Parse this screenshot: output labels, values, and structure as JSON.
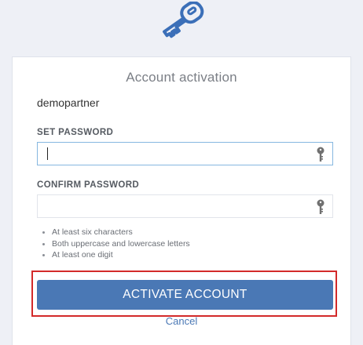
{
  "logo": {
    "icon": "key-icon",
    "color": "#3b6fb8"
  },
  "card": {
    "title": "Account activation",
    "username": "demopartner"
  },
  "form": {
    "set_password": {
      "label": "SET PASSWORD",
      "value": "",
      "icon": "key-icon"
    },
    "confirm_password": {
      "label": "CONFIRM PASSWORD",
      "value": "",
      "icon": "key-icon"
    },
    "rules": [
      "At least six characters",
      "Both uppercase and lowercase letters",
      "At least one digit"
    ],
    "activate_label": "ACTIVATE ACCOUNT",
    "cancel_label": "Cancel"
  },
  "colors": {
    "accent": "#4a78b5",
    "highlight": "#d32a2a",
    "background": "#eef0f6"
  }
}
